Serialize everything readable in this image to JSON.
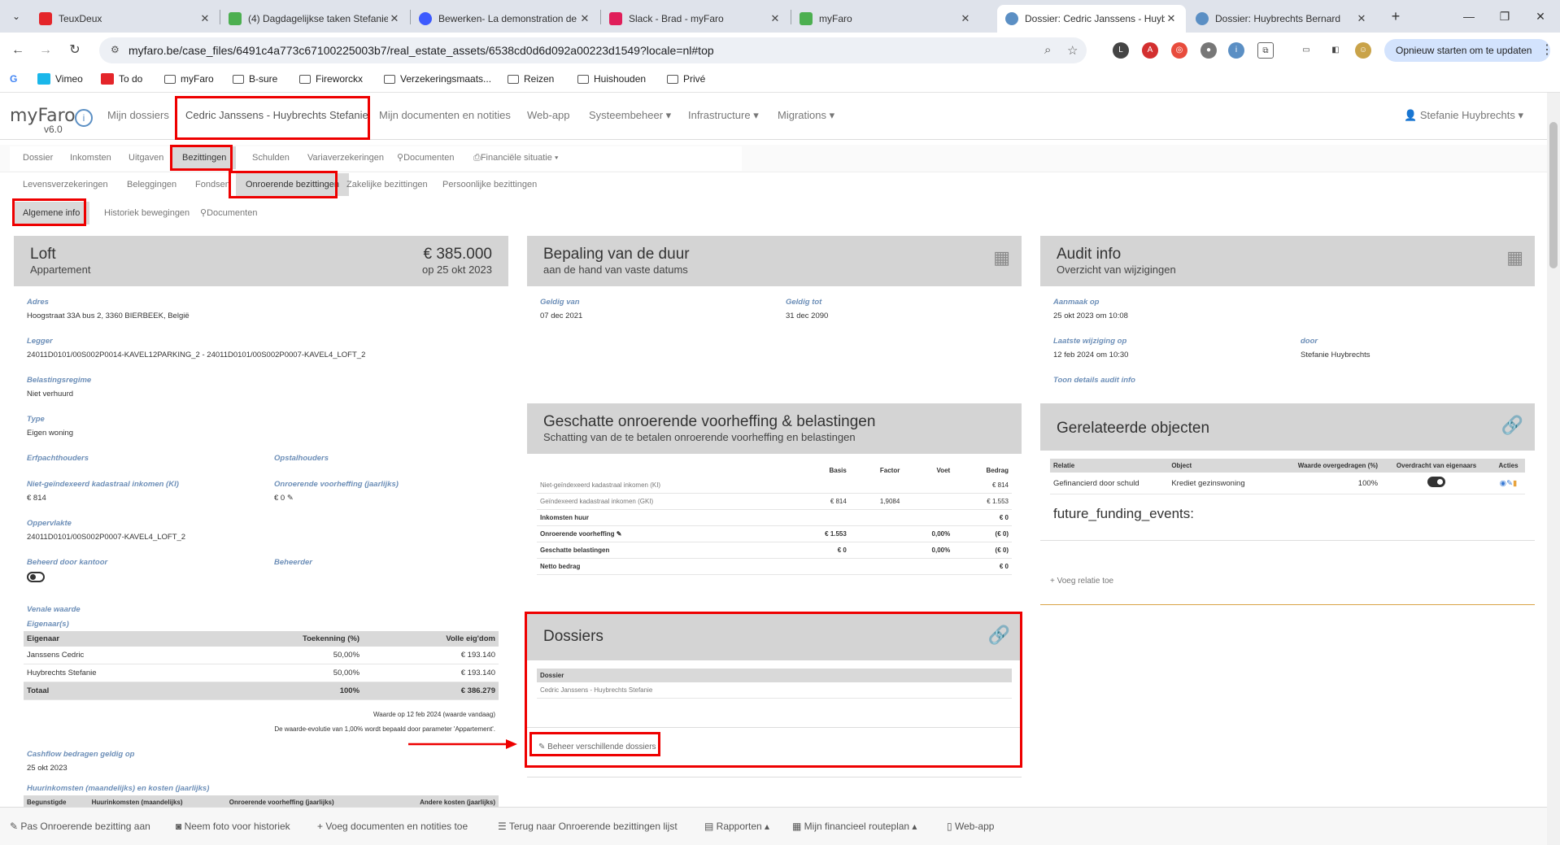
{
  "browser": {
    "tabs": [
      {
        "title": "TeuxDeux",
        "color": "#e4252a"
      },
      {
        "title": "(4) Dagdagelijkse taken Stefanie",
        "color": "#4caf50"
      },
      {
        "title": "Bewerken- La demonstration de",
        "color": "#3d5afe"
      },
      {
        "title": "Slack - Brad - myFaro",
        "color": "#e01e5a"
      },
      {
        "title": "myFaro",
        "color": "#4caf50"
      },
      {
        "title": "Dossier: Cedric Janssens - Huyb",
        "color": "#5b8fc4"
      },
      {
        "title": "Dossier: Huybrechts Bernard",
        "color": "#5b8fc4"
      }
    ],
    "url": "myfaro.be/case_files/6491c4a773c67100225003b7/real_estate_assets/6538cd0d6d092a00223d1549?locale=nl#top",
    "update_label": "Opnieuw starten om te updaten",
    "bookmarks": [
      "Vimeo",
      "To do",
      "myFaro",
      "B-sure",
      "Fireworckx",
      "Verzekeringsmaats...",
      "Reizen",
      "Huishouden",
      "Privé"
    ]
  },
  "app": {
    "brand": "myFaro",
    "version": "v6.0",
    "nav": [
      "Mijn dossiers",
      "Cedric Janssens - Huybrechts Stefanie",
      "Mijn documenten en notities",
      "Web-app",
      "Systeembeheer ▾",
      "Infrastructure ▾",
      "Migrations ▾"
    ],
    "user": "Stefanie Huybrechts ▾",
    "subnav1": [
      "Dossier",
      "Inkomsten",
      "Uitgaven",
      "Bezittingen",
      "Schulden",
      "Variaverzekeringen",
      "Documenten",
      "Financiële situatie ▾"
    ],
    "subnav2": [
      "Levensverzekeringen",
      "Beleggingen",
      "Fondsen",
      "Onroerende bezittingen",
      "Zakelijke bezittingen",
      "Persoonlijke bezittingen"
    ],
    "subnav3": [
      "Algemene info",
      "Historiek bewegingen",
      "Documenten"
    ]
  },
  "loft": {
    "title": "Loft",
    "subtitle": "Appartement",
    "amount": "€ 385.000",
    "amount_date": "op 25 okt 2023",
    "adres_label": "Adres",
    "adres": "Hoogstraat 33A bus 2, 3360 BIERBEEK, België",
    "legger_label": "Legger",
    "legger": "24011D0101/00S002P0014-KAVEL12PARKING_2 - 24011D0101/00S002P0007-KAVEL4_LOFT_2",
    "regime_label": "Belastingsregime",
    "regime": "Niet verhuurd",
    "type_label": "Type",
    "type": "Eigen woning",
    "erfpacht_label": "Erfpachthouders",
    "opstal_label": "Opstalhouders",
    "ki_label": "Niet-geïndexeerd kadastraal inkomen (KI)",
    "ki": "€ 814",
    "ov_label": "Onroerende voorheffing (jaarlijks)",
    "ov": "€ 0 ✎",
    "opp_label": "Oppervlakte",
    "opp": "24011D0101/00S002P0007-KAVEL4_LOFT_2",
    "beheerd_label": "Beheerd door kantoor",
    "beheerder_label": "Beheerder",
    "venale_label": "Venale waarde",
    "eigenaars_label": "Eigenaar(s)",
    "owners_head": [
      "Eigenaar",
      "Toekenning (%)",
      "Volle eig'dom"
    ],
    "owners": [
      [
        "Janssens Cedric",
        "50,00%",
        "€ 193.140"
      ],
      [
        "Huybrechts Stefanie",
        "50,00%",
        "€ 193.140"
      ],
      [
        "Totaal",
        "100%",
        "€ 386.279"
      ]
    ],
    "note1": "Waarde op 12 feb 2024 (waarde vandaag)",
    "note2": "De waarde-evolutie van 1,00% wordt bepaald door parameter 'Appartement'.",
    "cashflow_label": "Cashflow bedragen geldig op",
    "cashflow": "25 okt 2023",
    "huur_label": "Huurinkomsten (maandelijks) en kosten (jaarlijks)",
    "huur_head": [
      "Begunstigde",
      "Huurinkomsten (maandelijks)",
      "Onroerende voorheffing (jaarlijks)",
      "Andere kosten (jaarlijks)"
    ]
  },
  "duur": {
    "title": "Bepaling van de duur",
    "subtitle": "aan de hand van vaste datums",
    "van_label": "Geldig van",
    "van": "07 dec 2021",
    "tot_label": "Geldig tot",
    "tot": "31 dec 2090"
  },
  "voorheffing": {
    "title": "Geschatte onroerende voorheffing & belastingen",
    "subtitle": "Schatting van de te betalen onroerende voorheffing en belastingen",
    "head": [
      "",
      "Basis",
      "Factor",
      "Voet",
      "Bedrag"
    ],
    "rows": [
      [
        "Niet-geïndexeerd kadastraal inkomen (KI)",
        "",
        "",
        "",
        "€ 814"
      ],
      [
        "Geïndexeerd kadastraal inkomen (GKI)",
        "€ 814",
        "1,9084",
        "",
        "€ 1.553"
      ],
      [
        "Inkomsten huur",
        "",
        "",
        "",
        "€ 0"
      ],
      [
        "Onroerende voorheffing ✎",
        "€ 1.553",
        "",
        "0,00%",
        "(€ 0)"
      ],
      [
        "Geschatte belastingen",
        "€ 0",
        "",
        "0,00%",
        "(€ 0)"
      ],
      [
        "Netto bedrag",
        "",
        "",
        "",
        "€ 0"
      ]
    ]
  },
  "dossiers": {
    "title": "Dossiers",
    "head": "Dossier",
    "row": "Cedric Janssens - Huybrechts Stefanie",
    "manage": "✎ Beheer verschillende dossiers"
  },
  "audit": {
    "title": "Audit info",
    "subtitle": "Overzicht van wijzigingen",
    "aanmaak_label": "Aanmaak op",
    "aanmaak": "25 okt 2023 om 10:08",
    "laatste_label": "Laatste wijziging op",
    "laatste": "12 feb 2024 om 10:30",
    "door_label": "door",
    "door": "Stefanie Huybrechts",
    "details": "Toon details audit info"
  },
  "gerelateerd": {
    "title": "Gerelateerde objecten",
    "head": [
      "Relatie",
      "Object",
      "Waarde overgedragen (%)",
      "Overdracht van eigenaars",
      "Acties"
    ],
    "row": [
      "Gefinancierd door schuld",
      "Krediet gezinswoning",
      "100%"
    ],
    "future": "future_funding_events:",
    "add": "+ Voeg relatie toe"
  },
  "bottom": [
    "✎ Pas Onroerende bezitting aan",
    "◙ Neem foto voor historiek",
    "+ Voeg documenten en notities toe",
    "☰ Terug naar Onroerende bezittingen lijst",
    "▤ Rapporten ▴",
    "▦ Mijn financieel routeplan ▴",
    "▯ Web-app"
  ]
}
